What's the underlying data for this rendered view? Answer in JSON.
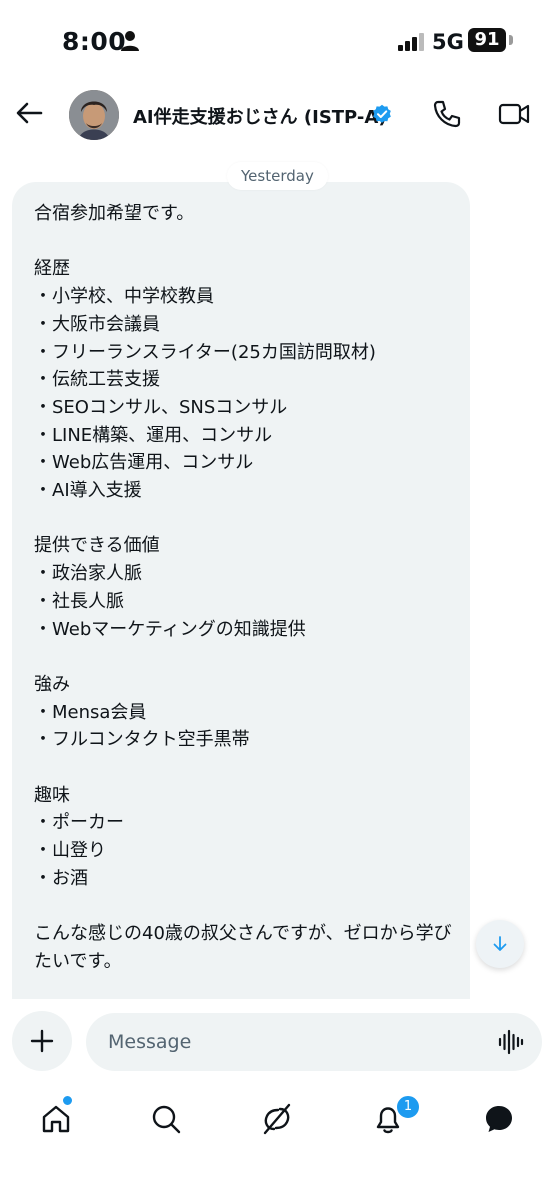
{
  "status_bar": {
    "time": "8:00",
    "network": "5G",
    "battery": "91"
  },
  "header": {
    "title": "AI伴走支援おじさん (ISTP-A)"
  },
  "chat": {
    "day_label": "Yesterday",
    "message": "合宿参加希望です。\n\n経歴\n・小学校、中学校教員\n・大阪市会議員\n・フリーランスライター(25カ国訪問取材)\n・伝統工芸支援\n・SEOコンサル、SNSコンサル\n・LINE構築、運用、コンサル\n・Web広告運用、コンサル\n・AI導入支援\n\n提供できる価値\n・政治家人脈\n・社長人脈\n・Webマーケティングの知識提供\n\n強み\n・Mensa会員\n・フルコンタクト空手黒帯\n\n趣味\n・ポーカー\n・山登り\n・お酒\n\nこんな感じの40歳の叔父さんですが、ゼロから学びたいです。"
  },
  "composer": {
    "placeholder": "Message"
  },
  "tabbar": {
    "notifications_count": "1"
  },
  "colors": {
    "accent": "#1d9bf0",
    "bubble": "#eff3f4",
    "text": "#0f1419"
  }
}
